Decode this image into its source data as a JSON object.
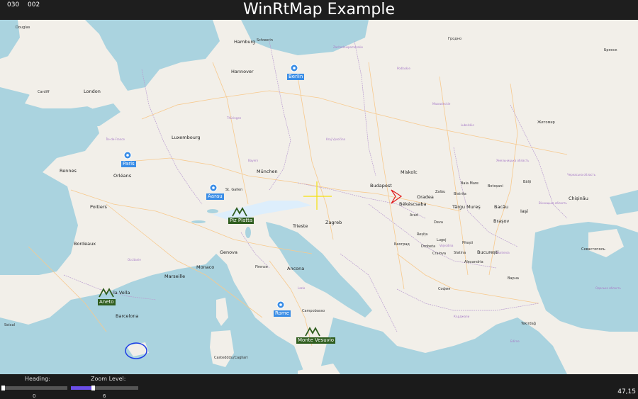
{
  "header": {
    "title": "WinRtMap Example",
    "counter_left": "030",
    "counter_right": "002"
  },
  "markers": {
    "berlin": "Berlin",
    "paris": "Paris",
    "aarau": "Aarau",
    "rome": "Rome",
    "piz_platta": "Piz Platta",
    "aneto": "Aneto",
    "monte_vesuvio": "Monte Vesuvio"
  },
  "cities": {
    "douglas": "Douglas",
    "hamburg": "Hamburg",
    "schwerin": "Schwerin",
    "hannover": "Hannover",
    "cardiff": "Cardiff",
    "london": "London",
    "luxembourg": "Luxembourg",
    "rennes": "Rennes",
    "orleans": "Orléans",
    "munchen": "München",
    "st_gallen": "St. Gallen",
    "poitiers": "Poitiers",
    "bordeaux": "Bordeaux",
    "genova": "Genova",
    "monaco": "Monaco",
    "marseille": "Marseille",
    "firenze": "Firenze",
    "ancona": "Ancona",
    "trieste": "Trieste",
    "zagreb": "Zagreb",
    "budapest": "Budapest",
    "oradea": "Oradea",
    "bekescsaba": "Békéscsaba",
    "arad": "Arad",
    "barcelona": "Barcelona",
    "miskolc": "Miskolc",
    "campobasso": "Campobasso",
    "cagliari": "Castedddu/Cagliari",
    "bucuresti": "București",
    "sofia": "София",
    "beograd": "Београд",
    "varna": "Варна",
    "brasov": "Brașov",
    "targu_mures": "Târgu Mureș",
    "bacau": "Bacău",
    "iasi": "Iași",
    "chisinau": "Chișinău",
    "sevastopol": "Севастополь",
    "tekirdag": "Tekirdağ",
    "zhytomyr": "Житомир",
    "grodno": "Гродно",
    "bryansk": "Брянск",
    "alexandria": "Alexandria",
    "craiova": "Craiova",
    "slatina": "Slatina",
    "pitesti": "Pitești",
    "deva": "Deva",
    "resita": "Reșița",
    "drobeta": "Drobeta",
    "lugoj": "Lugoj",
    "bistrita": "Bistrița",
    "zalau": "Zalău",
    "baia_mare": "Baia Mare",
    "botosani": "Botoșani",
    "balti": "Bălți",
    "la_vella": "la Vella",
    "seixal": "Seixal"
  },
  "controls": {
    "heading_label": "Heading:",
    "zoom_label": "Zoom Level:",
    "heading_value": "0",
    "zoom_value": "6",
    "heading_fraction": 0.0,
    "zoom_fraction": 0.33
  },
  "status": {
    "coordinates": "47,15"
  },
  "colors": {
    "land": "#f2efe9",
    "sea": "#aad3df",
    "border": "#b99cd0",
    "road": "#f7c98d",
    "marker_city": "#3a8de6",
    "marker_peak": "#2f5d1e"
  }
}
